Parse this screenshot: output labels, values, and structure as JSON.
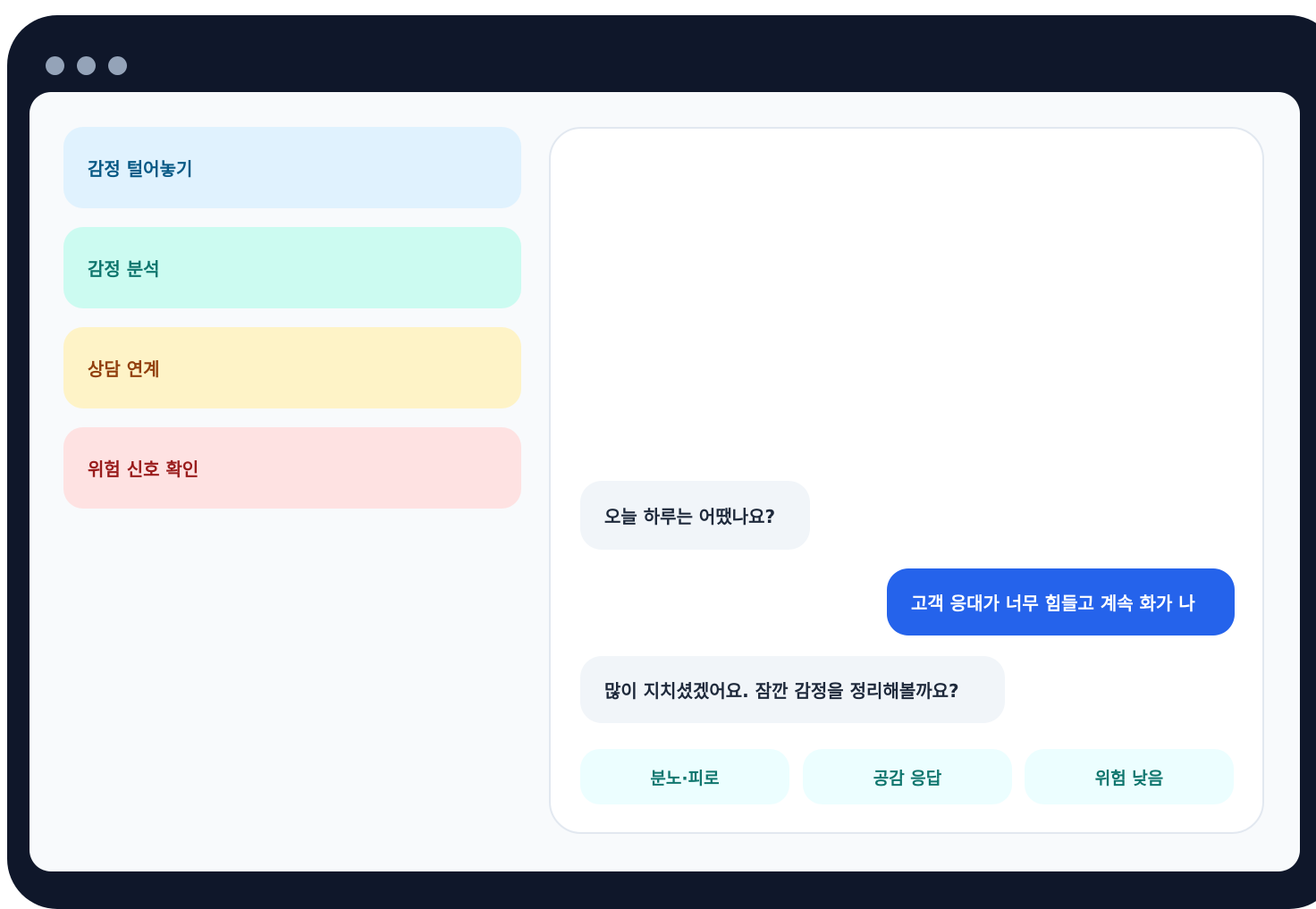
{
  "window": {
    "controls": [
      "dot",
      "dot",
      "dot"
    ]
  },
  "sidebar": {
    "items": [
      {
        "label": "감정 털어놓기",
        "bg": "#e0f2fe",
        "fg": "#075985"
      },
      {
        "label": "감정 분석",
        "bg": "#ccfbf1",
        "fg": "#0f766e"
      },
      {
        "label": "상담 연계",
        "bg": "#fef3c7",
        "fg": "#92400e"
      },
      {
        "label": "위험 신호 확인",
        "bg": "#fee2e2",
        "fg": "#991b1b"
      }
    ]
  },
  "chat": {
    "messages": [
      {
        "role": "bot",
        "text": "오늘 하루는 어땠나요?"
      },
      {
        "role": "user",
        "text": "고객 응대가 너무 힘들고 계속 화가 나"
      },
      {
        "role": "bot",
        "text": "많이 지치셨겠어요. 잠깐 감정을 정리해볼까요?"
      }
    ],
    "chips": [
      "분노·피로",
      "공감 응답",
      "위험 낮음"
    ]
  },
  "colors": {
    "frame": "#0f172a",
    "panel": "#f8fafc",
    "user_bubble": "#2563eb",
    "bot_bubble": "#f1f5f9",
    "chip_bg": "#ecfeff",
    "chip_text": "#0f766e"
  }
}
